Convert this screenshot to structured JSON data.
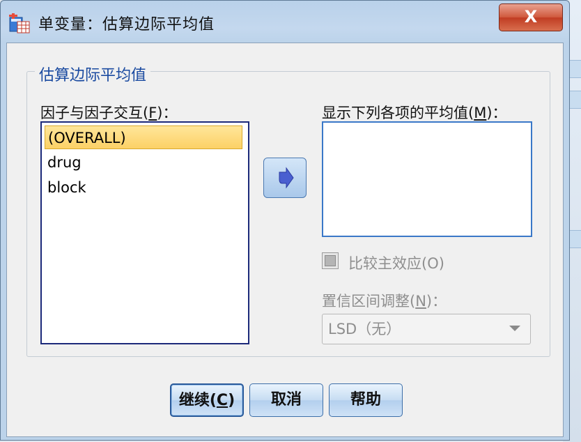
{
  "window": {
    "title": "单变量：估算边际平均值",
    "close_label": "X"
  },
  "group": {
    "title": "估算边际平均值"
  },
  "factors": {
    "label_prefix": "因子与因子交互(",
    "label_key": "F",
    "label_suffix": ")：",
    "items": [
      {
        "label": "(OVERALL)",
        "selected": true
      },
      {
        "label": "drug",
        "selected": false
      },
      {
        "label": "block",
        "selected": false
      }
    ]
  },
  "display_means": {
    "label_prefix": "显示下列各项的平均值(",
    "label_key": "M",
    "label_suffix": ")：",
    "items": []
  },
  "compare_main_effects": {
    "label": "比较主效应(O)",
    "checked": false,
    "enabled": false
  },
  "ci_adjustment": {
    "label_prefix": "置信区间调整(",
    "label_key": "N",
    "label_suffix": ")：",
    "selected_value": "LSD（无）",
    "enabled": false
  },
  "buttons": {
    "continue_prefix": "继续(",
    "continue_key": "C",
    "continue_suffix": ")",
    "cancel": "取消",
    "help": "帮助"
  },
  "colors": {
    "accent_blue": "#1a4aa0",
    "selection": "#fcd166",
    "close_red": "#c03c22"
  }
}
